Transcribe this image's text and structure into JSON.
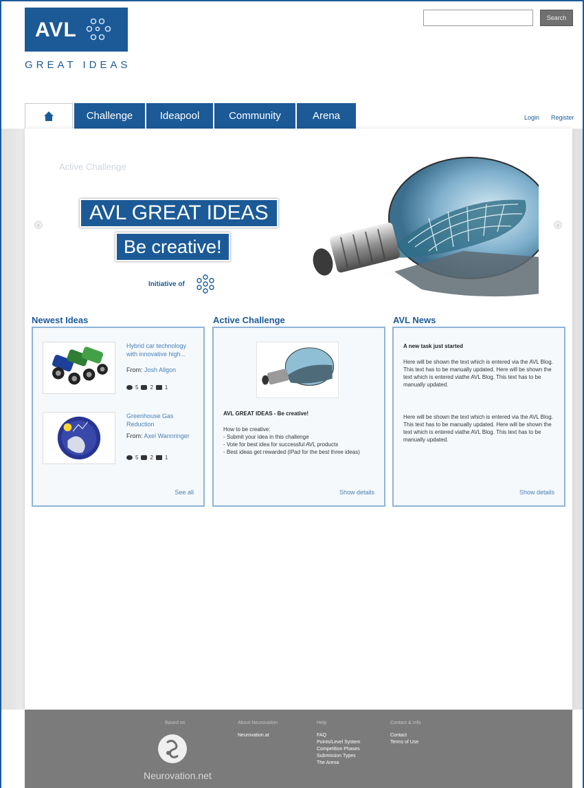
{
  "brand": {
    "logo_text": "AVL",
    "tagline": "GREAT IDEAS"
  },
  "search": {
    "placeholder": "",
    "button_label": "Search"
  },
  "nav": {
    "home_icon": "home-icon",
    "tabs": [
      "Challenge",
      "Ideapool",
      "Community",
      "Arena"
    ]
  },
  "auth": {
    "login": "Login",
    "register": "Register"
  },
  "hero": {
    "label": "Active Challenge",
    "title": "AVL GREAT IDEAS",
    "subtitle": "Be creative!",
    "initiative": "Initiative of",
    "prev_icon": "chevron-left-icon",
    "next_icon": "chevron-right-icon"
  },
  "newest_ideas": {
    "title": "Newest Ideas",
    "items": [
      {
        "title": "Hybrid car technology with innovative high...",
        "from_label": "From:",
        "author": "Josh Allgon",
        "views": "5",
        "comments": "2",
        "likes": "1"
      },
      {
        "title": "Greenhouse Gas Reduction",
        "from_label": "From:",
        "author": "Axel Wannringer",
        "views": "5",
        "comments": "2",
        "likes": "1"
      }
    ],
    "link": "See all"
  },
  "active_challenge": {
    "title": "Active Challenge",
    "heading": "AVL GREAT IDEAS - Be creative!",
    "intro": "How to be creative:",
    "bullets": [
      "- Submit your idea in this challenge",
      "- Vote for best idea for successful AVL products",
      "- Best ideas get rewarded (iPad for the best three ideas)"
    ],
    "link": "Show details"
  },
  "avl_news": {
    "title": "AVL News",
    "heading": "A new task just started",
    "paragraphs": [
      "Here will be shown the text which is entered via the AVL Blog. This text has to be manually updated. Here will be shown the text which is entered viathe AVL Blog. This text has to be manually updated.",
      "Here will be shown the text which is entered via the AVL Blog. This text has to be manually updated. Here will be shown the text which is entered viathe AVL Blog. This text has to be manually updated."
    ],
    "link": "Show details"
  },
  "footer": {
    "col1_head": "Based on",
    "logo_text": "Neurovation.net",
    "col2_head": "About Neurovation",
    "col2_links": [
      "Neurovation.at"
    ],
    "col3_head": "Help",
    "col3_links": [
      "FAQ",
      "Points/Level System",
      "Competition Phases",
      "Submission Types",
      "The Arena"
    ],
    "col4_head": "Contact & Info",
    "col4_links": [
      "Contact",
      "Terms of Use"
    ]
  },
  "colors": {
    "brand_blue": "#1b5a97",
    "panel_border": "#8cb4d9",
    "footer_grey": "#7b7b7b"
  }
}
